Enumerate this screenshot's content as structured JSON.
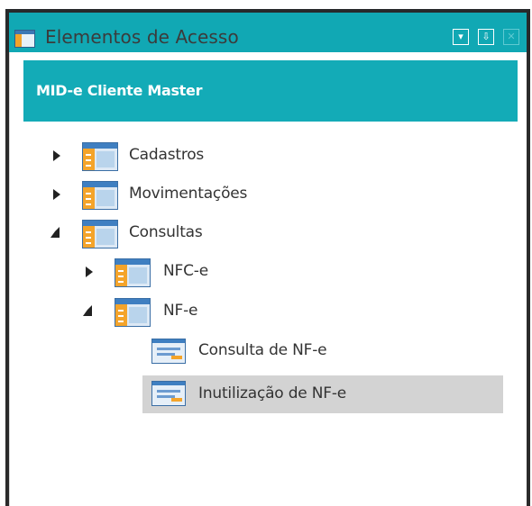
{
  "window": {
    "title": "Elementos de Acesso",
    "buttons": {
      "dropdown": "▾",
      "pin": "⇩",
      "close": "✕"
    }
  },
  "banner": {
    "text": "MID-e Cliente Master"
  },
  "tree": {
    "cadastros": "Cadastros",
    "movimentacoes": "Movimentações",
    "consultas": "Consultas",
    "nfce": "NFC-e",
    "nfe": "NF-e",
    "consulta_nfe": "Consulta de NF-e",
    "inutilizacao_nfe": "Inutilização de NF-e"
  },
  "colors": {
    "accent": "#13abb7",
    "selection": "#d3d3d3"
  }
}
